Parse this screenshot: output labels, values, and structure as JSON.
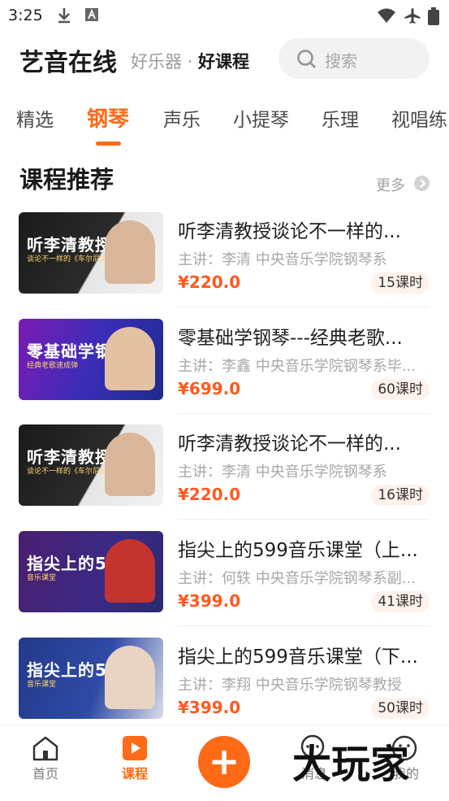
{
  "status_bar": {
    "time": "3:25"
  },
  "header": {
    "brand": "艺音在线",
    "slogan_1": "好乐器",
    "slogan_sep": " · ",
    "slogan_2": "好课程",
    "search_placeholder": "搜索"
  },
  "tabs": [
    {
      "label": "精选"
    },
    {
      "label": "钢琴",
      "active": true
    },
    {
      "label": "声乐"
    },
    {
      "label": "小提琴"
    },
    {
      "label": "乐理"
    },
    {
      "label": "视唱练"
    }
  ],
  "section": {
    "title": "课程推荐",
    "more": "更多"
  },
  "courses": [
    {
      "thumb_title": "听李清教授",
      "thumb_sub": "谈论不一样的《车尔尼599》",
      "title": "听李清教授谈论不一样的...",
      "teacher": "主讲：李清 中央音乐学院钢琴系",
      "price": "¥220.0",
      "lessons": "15课时"
    },
    {
      "thumb_title": "零基础学钢琴",
      "thumb_sub": "经典老歌速成弹",
      "title": "零基础学钢琴---经典老歌...",
      "teacher": "主讲：李鑫 中央音乐学院钢琴系毕...",
      "price": "¥699.0",
      "lessons": "60课时"
    },
    {
      "thumb_title": "听李清教授",
      "thumb_sub": "谈论不一样的《车尔尼599》（下）",
      "title": "听李清教授谈论不一样的...",
      "teacher": "主讲：李清 中央音乐学院钢琴系",
      "price": "¥220.0",
      "lessons": "16课时"
    },
    {
      "thumb_title": "指尖上的599",
      "thumb_sub": "音乐课堂",
      "title": "指尖上的599音乐课堂（上...",
      "teacher": "主讲：何轶 中央音乐学院钢琴系副...",
      "price": "¥399.0",
      "lessons": "41课时"
    },
    {
      "thumb_title": "指尖上的599",
      "thumb_sub": "音乐课堂",
      "title": "指尖上的599音乐课堂（下...",
      "teacher": "主讲：李翔 中央音乐学院钢琴教授",
      "price": "¥399.0",
      "lessons": "50课时"
    }
  ],
  "bottom_nav": [
    {
      "label": "首页",
      "icon": "home-icon"
    },
    {
      "label": "课程",
      "icon": "course-icon",
      "active": true
    },
    {
      "label": "消息",
      "icon": "message-icon"
    },
    {
      "label": "我的",
      "icon": "profile-icon"
    }
  ],
  "watermark": "大玩家",
  "colors": {
    "accent": "#ff6a16",
    "price": "#ff5a1f"
  }
}
